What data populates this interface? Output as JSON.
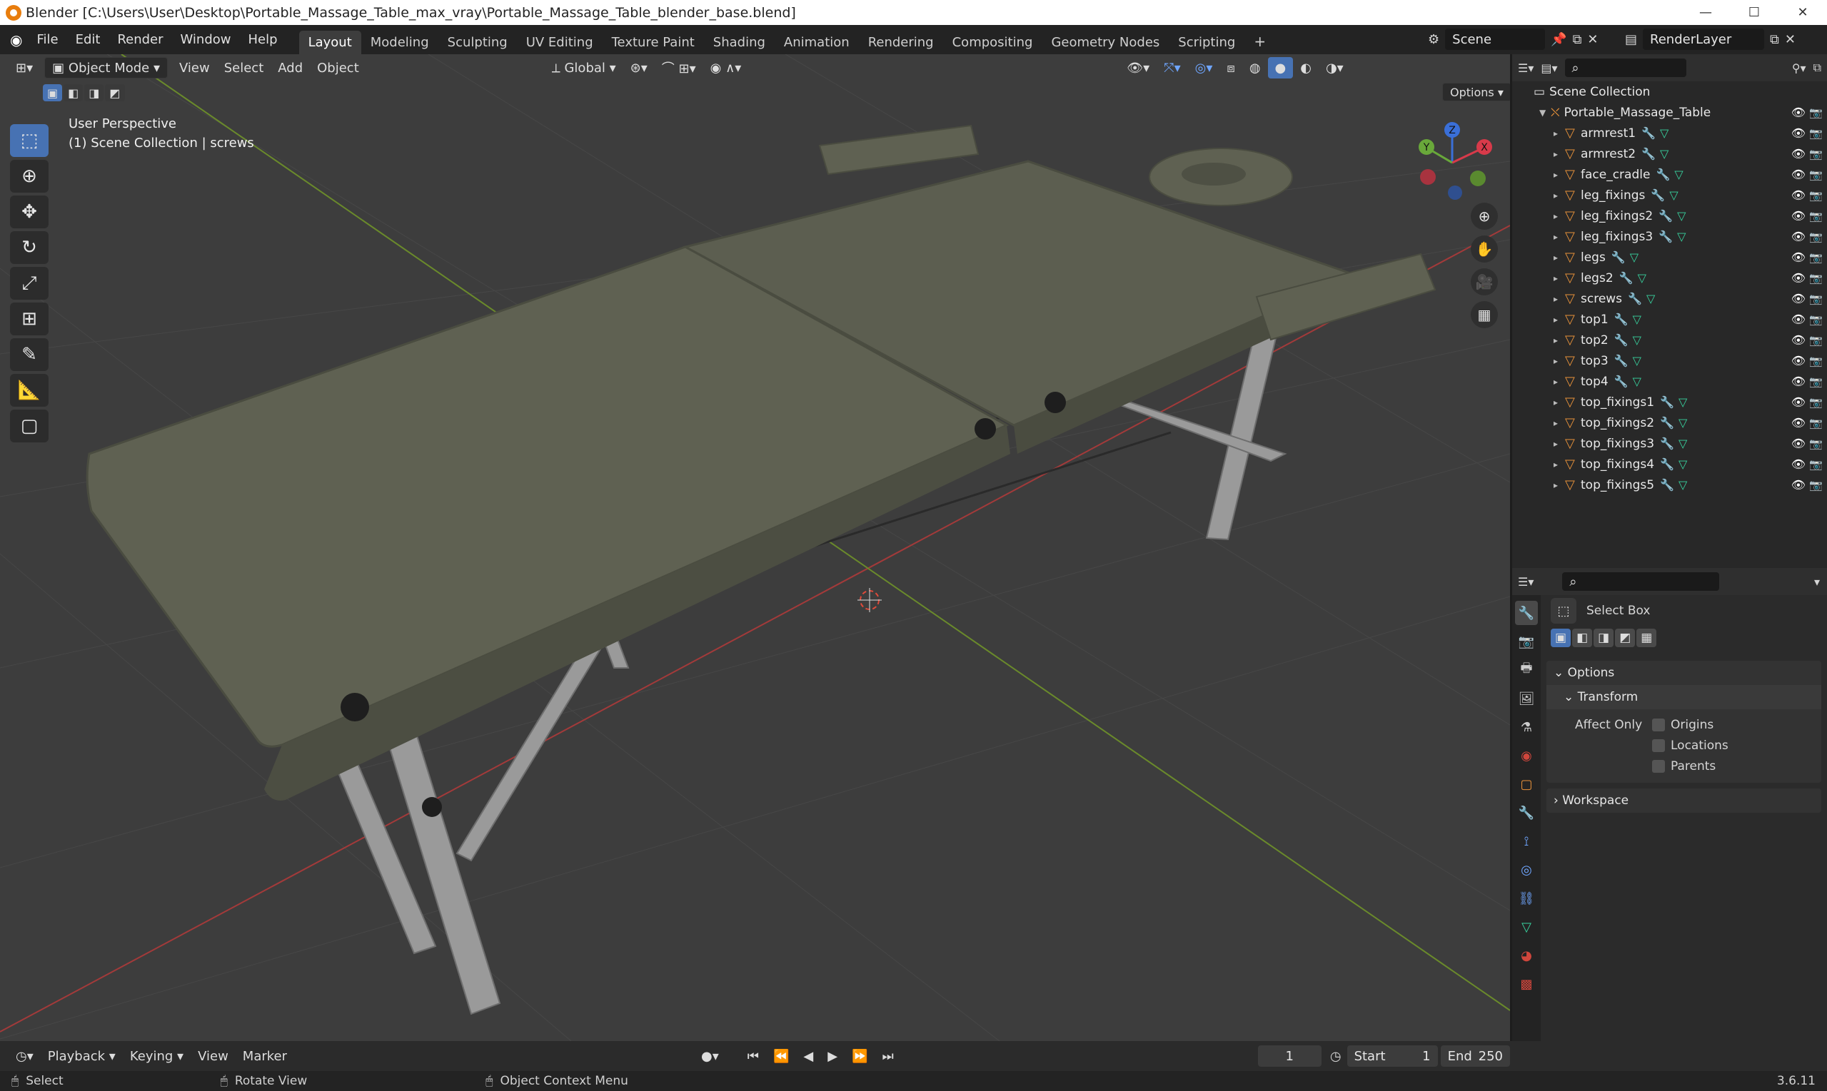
{
  "window": {
    "title": "Blender [C:\\Users\\User\\Desktop\\Portable_Massage_Table_max_vray\\Portable_Massage_Table_blender_base.blend]"
  },
  "menu": {
    "items": [
      "File",
      "Edit",
      "Render",
      "Window",
      "Help"
    ]
  },
  "workspaces": [
    {
      "label": "Layout",
      "active": true
    },
    {
      "label": "Modeling"
    },
    {
      "label": "Sculpting"
    },
    {
      "label": "UV Editing"
    },
    {
      "label": "Texture Paint"
    },
    {
      "label": "Shading"
    },
    {
      "label": "Animation"
    },
    {
      "label": "Rendering"
    },
    {
      "label": "Compositing"
    },
    {
      "label": "Geometry Nodes"
    },
    {
      "label": "Scripting"
    }
  ],
  "scene": {
    "name": "Scene",
    "render_layer": "RenderLayer"
  },
  "viewport": {
    "mode": "Object Mode",
    "menus": [
      "View",
      "Select",
      "Add",
      "Object"
    ],
    "transform_orientation": "Global",
    "options_label": "Options",
    "perspective": "User Perspective",
    "collection_info": "(1) Scene Collection | screws",
    "gizmo": {
      "x": "X",
      "y": "Y",
      "z": "Z"
    }
  },
  "outliner": {
    "root": "Scene Collection",
    "collection": "Portable_Massage_Table",
    "objects": [
      "armrest1",
      "armrest2",
      "face_cradle",
      "leg_fixings",
      "leg_fixings2",
      "leg_fixings3",
      "legs",
      "legs2",
      "screws",
      "top1",
      "top2",
      "top3",
      "top4",
      "top_fixings1",
      "top_fixings2",
      "top_fixings3",
      "top_fixings4",
      "top_fixings5"
    ]
  },
  "properties": {
    "tool_name": "Select Box",
    "options_label": "Options",
    "transform_label": "Transform",
    "affect_only_label": "Affect Only",
    "origins": "Origins",
    "locations": "Locations",
    "parents": "Parents",
    "workspace_label": "Workspace"
  },
  "timeline": {
    "menus": [
      "Playback",
      "Keying",
      "View",
      "Marker"
    ],
    "current_frame": "1",
    "start_label": "Start",
    "start": "1",
    "end_label": "End",
    "end": "250"
  },
  "status": {
    "select": "Select",
    "rotate": "Rotate View",
    "context": "Object Context Menu",
    "version": "3.6.11"
  }
}
